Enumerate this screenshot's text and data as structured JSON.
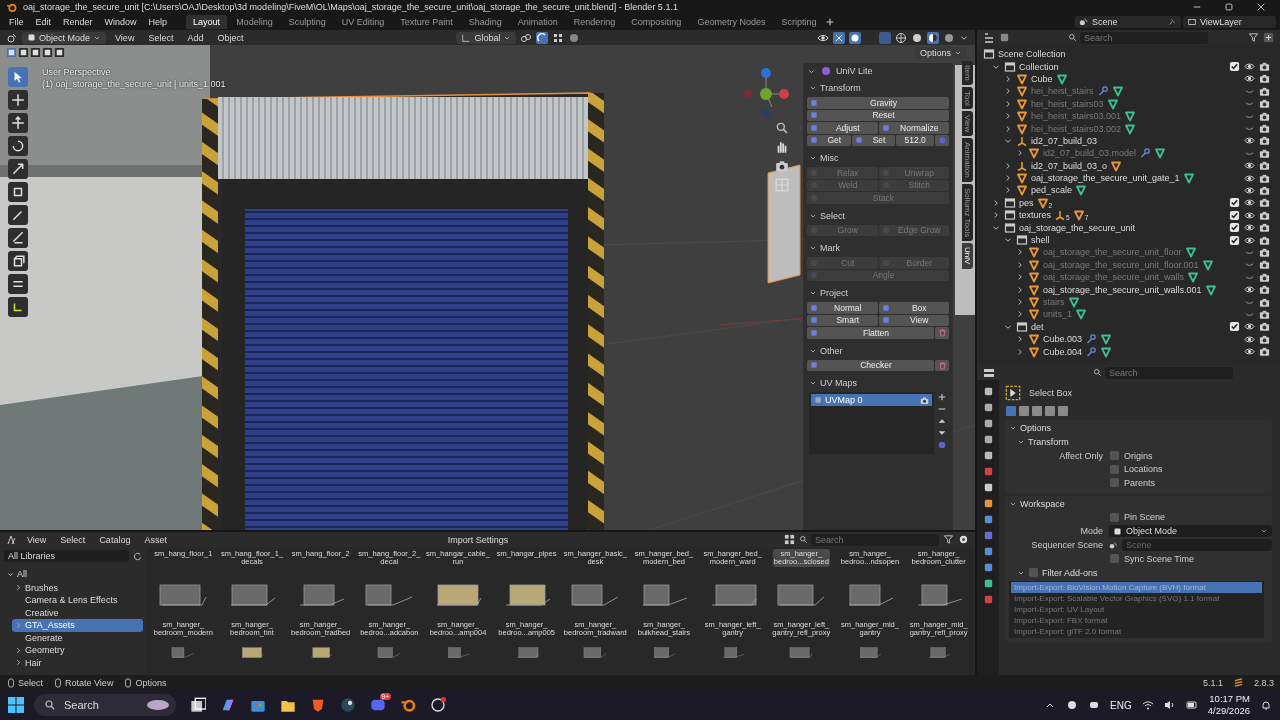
{
  "window": {
    "title": "oaj_storage_the_secure_unit [C:\\Users\\OAJ\\Desktop\\3d modeling\\FiveM\\OL\\Maps\\oaj_storage_the_secure_unit\\oaj_storage_the_secure_unit.blend] - Blender 5.1.1"
  },
  "menu": [
    "File",
    "Edit",
    "Render",
    "Window",
    "Help"
  ],
  "workspaces": [
    {
      "label": "Layout",
      "selected": true
    },
    {
      "label": "Modeling",
      "selected": false
    },
    {
      "label": "Sculpting",
      "selected": false
    },
    {
      "label": "UV Editing",
      "selected": false
    },
    {
      "label": "Texture Paint",
      "selected": false
    },
    {
      "label": "Shading",
      "selected": false
    },
    {
      "label": "Animation",
      "selected": false
    },
    {
      "label": "Rendering",
      "selected": false
    },
    {
      "label": "Compositing",
      "selected": false
    },
    {
      "label": "Geometry Nodes",
      "selected": false
    },
    {
      "label": "Scripting",
      "selected": false
    }
  ],
  "scene": "Scene",
  "view_layer": "ViewLayer",
  "viewport": {
    "mode": "Object Mode",
    "menus": [
      "View",
      "Select",
      "Add",
      "Object"
    ],
    "orientation": "Global",
    "options": "Options",
    "view_name": "User Perspective",
    "object_info": "(1) oaj_storage_the_secure_unit | units_1.001"
  },
  "n_panel": {
    "title": "UniV Lite",
    "sections": [
      {
        "title": "Transform",
        "disabled": false,
        "rows": [
          {
            "items": [
              {
                "kind": "button",
                "label": "Gravity"
              }
            ]
          },
          {
            "items": [
              {
                "kind": "button",
                "label": "Reset"
              }
            ]
          },
          {
            "items": [
              {
                "kind": "button",
                "label": "Adjust"
              },
              {
                "kind": "button",
                "label": "Normalize"
              }
            ]
          },
          {
            "items": [
              {
                "kind": "button",
                "label": "Get"
              },
              {
                "kind": "button",
                "label": "Set"
              },
              {
                "kind": "value",
                "label": "512.0"
              }
            ]
          }
        ]
      },
      {
        "title": "Misc",
        "disabled": true,
        "rows": [
          {
            "items": [
              {
                "kind": "button",
                "label": "Relax"
              },
              {
                "kind": "button",
                "label": "Unwrap"
              }
            ]
          },
          {
            "items": [
              {
                "kind": "button",
                "label": "Weld"
              },
              {
                "kind": "button",
                "label": "Stitch"
              }
            ]
          },
          {
            "items": [
              {
                "kind": "button",
                "label": "Stack"
              }
            ]
          }
        ]
      },
      {
        "title": "Select",
        "disabled": true,
        "rows": [
          {
            "items": [
              {
                "kind": "button",
                "label": "Grow"
              },
              {
                "kind": "button",
                "label": "Edge Grow"
              }
            ]
          }
        ]
      },
      {
        "title": "Mark",
        "disabled": true,
        "rows": [
          {
            "items": [
              {
                "kind": "button",
                "label": "Cut"
              },
              {
                "kind": "button",
                "label": "Border"
              }
            ]
          },
          {
            "items": [
              {
                "kind": "button",
                "label": "Angle"
              }
            ]
          }
        ]
      },
      {
        "title": "Project",
        "disabled": false,
        "rows": [
          {
            "items": [
              {
                "kind": "button",
                "label": "Normal"
              },
              {
                "kind": "button",
                "label": "Box"
              }
            ]
          },
          {
            "items": [
              {
                "kind": "button",
                "label": "Smart"
              },
              {
                "kind": "button",
                "label": "View"
              }
            ]
          },
          {
            "items": [
              {
                "kind": "button",
                "label": "Flatten"
              },
              {
                "kind": "delete"
              }
            ]
          }
        ]
      },
      {
        "title": "Other",
        "disabled": false,
        "rows": [
          {
            "items": [
              {
                "kind": "button",
                "label": "Checker"
              },
              {
                "kind": "delete"
              }
            ]
          }
        ]
      }
    ],
    "uv_maps": {
      "title": "UV Maps",
      "items": [
        {
          "label": "UVMap 0",
          "selected": true
        }
      ]
    },
    "tabs": [
      {
        "label": "Item",
        "selected": false
      },
      {
        "label": "Tool",
        "selected": false
      },
      {
        "label": "View",
        "selected": false
      },
      {
        "label": "Animation",
        "selected": false
      },
      {
        "label": "Sollumz Tools",
        "selected": false
      },
      {
        "label": "UniV",
        "selected": true
      }
    ]
  },
  "outliner": {
    "search_placeholder": "Search",
    "items": [
      {
        "name": "Scene Collection",
        "kind": "scene_collection",
        "children": [
          {
            "name": "Collection",
            "kind": "collection",
            "expanded": true,
            "checked": true,
            "hidden": false,
            "children": [
              {
                "name": "Cube",
                "kind": "mesh",
                "expanded": false,
                "hidden": false,
                "extras": [
                  {
                    "kind": "mesh"
                  }
                ]
              },
              {
                "name": "hei_heist_stairs",
                "kind": "mesh",
                "expanded": false,
                "hidden": true,
                "extras": [
                  {
                    "kind": "modifier"
                  },
                  {
                    "kind": "mesh"
                  }
                ]
              },
              {
                "name": "hei_heist_stairs03",
                "kind": "mesh",
                "expanded": false,
                "hidden": true,
                "extras": [
                  {
                    "kind": "mesh"
                  }
                ]
              },
              {
                "name": "hei_heist_stairs03.001",
                "kind": "mesh",
                "expanded": false,
                "hidden": true,
                "extras": [
                  {
                    "kind": "mesh"
                  }
                ]
              },
              {
                "name": "hei_heist_stairs03.002",
                "kind": "mesh",
                "expanded": false,
                "hidden": true,
                "extras": [
                  {
                    "kind": "mesh"
                  }
                ]
              },
              {
                "name": "id2_07_build_03",
                "kind": "empty",
                "expanded": true,
                "hidden": false,
                "children": [
                  {
                    "name": "id2_07_build_03.model",
                    "kind": "mesh",
                    "expanded": false,
                    "hidden": true,
                    "extras": [
                      {
                        "kind": "modifier"
                      },
                      {
                        "kind": "mesh"
                      }
                    ]
                  }
                ]
              },
              {
                "name": "id2_07_build_03_o",
                "kind": "empty",
                "expanded": false,
                "hidden": false,
                "extras": [
                  {
                    "kind": "child_mesh"
                  }
                ]
              },
              {
                "name": "oaj_storage_the_secure_unit_gate_1",
                "kind": "mesh",
                "expanded": false,
                "hidden": false,
                "extras": [
                  {
                    "kind": "mesh"
                  }
                ]
              },
              {
                "name": "ped_scale",
                "kind": "mesh",
                "expanded": false,
                "hidden": false,
                "extras": [
                  {
                    "kind": "mesh"
                  }
                ]
              }
            ]
          },
          {
            "name": "pes",
            "kind": "collection",
            "expanded": false,
            "checked": true,
            "hidden": false,
            "badges": [
              {
                "kind": "child_mesh",
                "count": "2"
              }
            ]
          },
          {
            "name": "textures",
            "kind": "collection",
            "expanded": false,
            "checked": true,
            "hidden": false,
            "badges": [
              {
                "kind": "empty",
                "count": "5"
              },
              {
                "kind": "child_mesh",
                "count": "7"
              }
            ]
          },
          {
            "name": "oaj_storage_the_secure_unit",
            "kind": "collection",
            "expanded": true,
            "checked": true,
            "hidden": false,
            "children": [
              {
                "name": "shell",
                "kind": "collection",
                "expanded": true,
                "checked": true,
                "hidden": false,
                "children": [
                  {
                    "name": "oaj_storage_the_secure_unit_floor",
                    "kind": "mesh",
                    "expanded": false,
                    "hidden": true,
                    "extras": [
                      {
                        "kind": "mesh"
                      }
                    ]
                  },
                  {
                    "name": "oaj_storage_the_secure_unit_floor.001",
                    "kind": "mesh",
                    "expanded": false,
                    "hidden": true,
                    "extras": [
                      {
                        "kind": "mesh"
                      }
                    ]
                  },
                  {
                    "name": "oaj_storage_the_secure_unit_walls",
                    "kind": "mesh",
                    "expanded": false,
                    "hidden": true,
                    "extras": [
                      {
                        "kind": "mesh"
                      }
                    ]
                  },
                  {
                    "name": "oaj_storage_the_secure_unit_walls.001",
                    "kind": "mesh",
                    "expanded": false,
                    "hidden": false,
                    "extras": [
                      {
                        "kind": "mesh"
                      }
                    ]
                  },
                  {
                    "name": "stairs",
                    "kind": "mesh",
                    "expanded": false,
                    "hidden": true,
                    "extras": [
                      {
                        "kind": "mesh"
                      }
                    ]
                  },
                  {
                    "name": "units_1",
                    "kind": "mesh",
                    "expanded": false,
                    "hidden": true,
                    "extras": [
                      {
                        "kind": "mesh"
                      }
                    ]
                  }
                ]
              },
              {
                "name": "det",
                "kind": "collection",
                "expanded": true,
                "checked": true,
                "hidden": false,
                "children": [
                  {
                    "name": "Cube.003",
                    "kind": "mesh",
                    "expanded": false,
                    "hidden": false,
                    "extras": [
                      {
                        "kind": "modifier"
                      },
                      {
                        "kind": "mesh"
                      }
                    ]
                  },
                  {
                    "name": "Cube.004",
                    "kind": "mesh",
                    "expanded": false,
                    "hidden": false,
                    "extras": [
                      {
                        "kind": "modifier"
                      },
                      {
                        "kind": "mesh"
                      }
                    ]
                  }
                ]
              }
            ]
          }
        ]
      }
    ]
  },
  "properties": {
    "search_placeholder": "Search",
    "tool": "Select Box",
    "options": {
      "title": "Options",
      "transform_title": "Transform",
      "affect_only_label": "Affect Only",
      "affect_only": [
        {
          "label": "Origins",
          "checked": false
        },
        {
          "label": "Locations",
          "checked": false
        },
        {
          "label": "Parents",
          "checked": false
        }
      ]
    },
    "workspace": {
      "title": "Workspace",
      "pin_scene": {
        "label": "Pin Scene",
        "checked": false
      },
      "mode_label": "Mode",
      "mode": "Object Mode",
      "sequencer_label": "Sequencer Scene",
      "sequencer_placeholder": "Scene",
      "sync": {
        "label": "Sync Scene Time",
        "checked": false
      },
      "filter": {
        "label": "Filter Add-ons",
        "checked": false
      },
      "addons": [
        {
          "label": "Import-Export: BioVision Motion Capture (BVH) format",
          "selected": true
        },
        {
          "label": "Import-Export: Scalable Vector Graphics (SVG) 1.1 format",
          "selected": false
        },
        {
          "label": "Import-Export: UV Layout",
          "selected": false
        },
        {
          "label": "Import-Export: FBX format",
          "selected": false
        },
        {
          "label": "Import-Export: glTF 2.0 format",
          "selected": false
        }
      ]
    }
  },
  "asset_browser": {
    "menus": [
      "View",
      "Select",
      "Catalog",
      "Asset"
    ],
    "import_settings": "Import Settings",
    "search_placeholder": "Search",
    "library": "All Libraries",
    "catalogs": [
      {
        "label": "All",
        "expanded": true,
        "selected": false,
        "children": [
          {
            "label": "Brushes",
            "expanded": false,
            "selected": false
          },
          {
            "label": "Camera & Lens Effects",
            "selected": false
          },
          {
            "label": "Creative",
            "selected": false
          },
          {
            "label": "GTA_Assets",
            "expanded": false,
            "selected": true
          },
          {
            "label": "Generate",
            "selected": false
          },
          {
            "label": "Geometry",
            "expanded": false,
            "selected": false
          },
          {
            "label": "Hair",
            "expanded": false,
            "selected": false
          }
        ]
      }
    ],
    "label_row": [
      {
        "name": "sm_hang_floor_1",
        "selected": false
      },
      {
        "name": "sm_hang_floor_1_\ndecals",
        "selected": false
      },
      {
        "name": "sm_hang_floor_2",
        "selected": false
      },
      {
        "name": "sm_hang_floor_2_\ndecal",
        "selected": false
      },
      {
        "name": "sm_hangar_cable_\nrun",
        "selected": false
      },
      {
        "name": "sm_hangar_pipes",
        "selected": false
      },
      {
        "name": "sm_hanger_basic_\ndesk",
        "selected": false
      },
      {
        "name": "sm_hanger_bed_\nmodern_bed",
        "selected": false
      },
      {
        "name": "sm_hanger_bed_\nmodern_ward",
        "selected": false
      },
      {
        "name": "sm_hanger_\nbedroo...sclosed",
        "selected": true
      },
      {
        "name": "sm_hanger_\nbedroo...ndsopen",
        "selected": false
      },
      {
        "name": "sm_hanger_\nbedroom_clutter",
        "selected": false
      }
    ],
    "assets": [
      {
        "name": "sm_hanger_\nbedroom_modern",
        "selected": false
      },
      {
        "name": "sm_hanger_\nbedroom_tint",
        "selected": false
      },
      {
        "name": "sm_hanger_\nbedroom_tradbed",
        "selected": false
      },
      {
        "name": "sm_hanger_\nbedroo...adcabon",
        "selected": false
      },
      {
        "name": "sm_hanger_\nbedroo...amp004",
        "selected": false
      },
      {
        "name": "sm_hanger_\nbedroo...amp005",
        "selected": false
      },
      {
        "name": "sm_hanger_\nbedroom_tradward",
        "selected": false
      },
      {
        "name": "sm_hanger_\nbulkhead_stairs",
        "selected": false
      },
      {
        "name": "sm_hanger_left_\ngantry",
        "selected": false
      },
      {
        "name": "sm_hanger_left_\ngantry_refl_proxy",
        "selected": false
      },
      {
        "name": "sm_hanger_mid_\ngantry",
        "selected": false
      },
      {
        "name": "sm_hanger_mid_\ngantry_refl_proxy",
        "selected": false
      }
    ]
  },
  "status_bar": {
    "hints": [
      "Select",
      "Rotate View",
      "Options"
    ],
    "version": "5.1.1",
    "addon_version": "2.8.3"
  },
  "taskbar": {
    "search": "Search",
    "discord_badge": "9+",
    "language": "ENG",
    "time": "10:17 PM",
    "date": "4/29/2026"
  }
}
